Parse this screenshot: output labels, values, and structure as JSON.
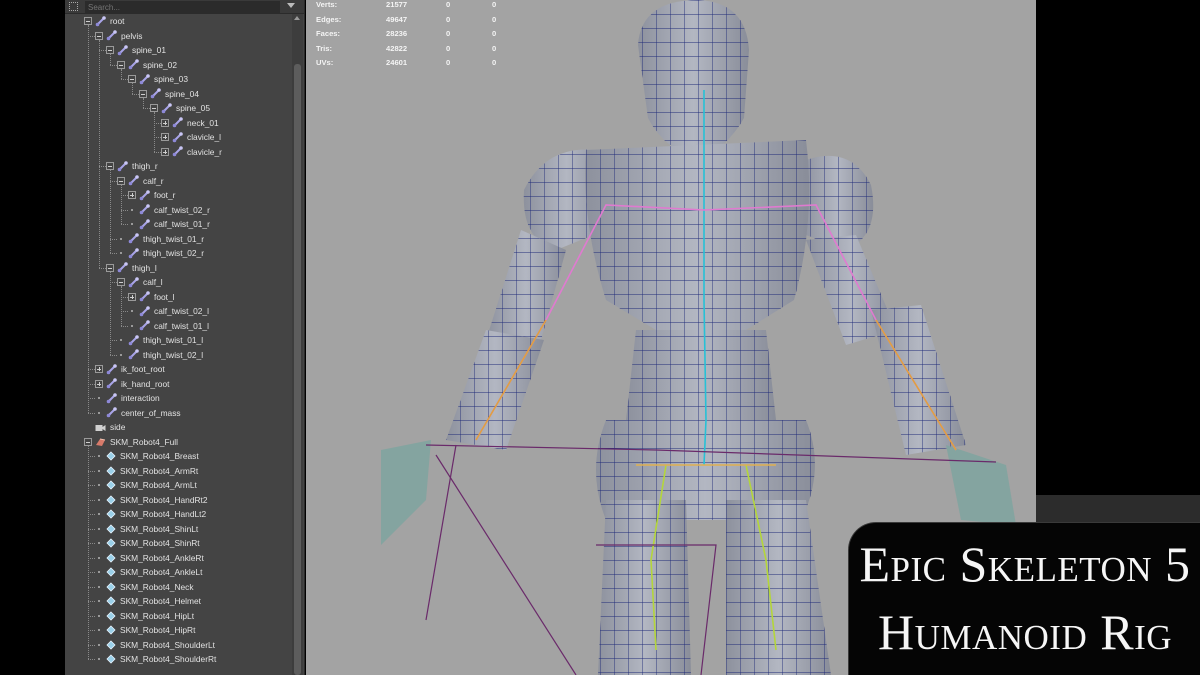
{
  "search": {
    "placeholder": "Search..."
  },
  "outliner": {
    "rows": [
      {
        "label": "root",
        "indent": 0,
        "kind": "minus",
        "icon": "joint"
      },
      {
        "label": "pelvis",
        "indent": 1,
        "kind": "minus",
        "icon": "joint"
      },
      {
        "label": "spine_01",
        "indent": 2,
        "kind": "minus",
        "icon": "joint"
      },
      {
        "label": "spine_02",
        "indent": 3,
        "kind": "minus",
        "icon": "joint"
      },
      {
        "label": "spine_03",
        "indent": 4,
        "kind": "minus",
        "icon": "joint"
      },
      {
        "label": "spine_04",
        "indent": 5,
        "kind": "minus",
        "icon": "joint"
      },
      {
        "label": "spine_05",
        "indent": 6,
        "kind": "minus",
        "icon": "joint"
      },
      {
        "label": "neck_01",
        "indent": 7,
        "kind": "plus",
        "icon": "joint"
      },
      {
        "label": "clavicle_l",
        "indent": 7,
        "kind": "plus",
        "icon": "joint"
      },
      {
        "label": "clavicle_r",
        "indent": 7,
        "kind": "plus",
        "icon": "joint"
      },
      {
        "label": "thigh_r",
        "indent": 2,
        "kind": "minus",
        "icon": "joint"
      },
      {
        "label": "calf_r",
        "indent": 3,
        "kind": "minus",
        "icon": "joint"
      },
      {
        "label": "foot_r",
        "indent": 4,
        "kind": "plus",
        "icon": "joint"
      },
      {
        "label": "calf_twist_02_r",
        "indent": 4,
        "kind": "dot",
        "icon": "joint"
      },
      {
        "label": "calf_twist_01_r",
        "indent": 4,
        "kind": "dot",
        "icon": "joint"
      },
      {
        "label": "thigh_twist_01_r",
        "indent": 3,
        "kind": "dot",
        "icon": "joint"
      },
      {
        "label": "thigh_twist_02_r",
        "indent": 3,
        "kind": "dot",
        "icon": "joint"
      },
      {
        "label": "thigh_l",
        "indent": 2,
        "kind": "minus",
        "icon": "joint"
      },
      {
        "label": "calf_l",
        "indent": 3,
        "kind": "minus",
        "icon": "joint"
      },
      {
        "label": "foot_l",
        "indent": 4,
        "kind": "plus",
        "icon": "joint"
      },
      {
        "label": "calf_twist_02_l",
        "indent": 4,
        "kind": "dot",
        "icon": "joint"
      },
      {
        "label": "calf_twist_01_l",
        "indent": 4,
        "kind": "dot",
        "icon": "joint"
      },
      {
        "label": "thigh_twist_01_l",
        "indent": 3,
        "kind": "dot",
        "icon": "joint"
      },
      {
        "label": "thigh_twist_02_l",
        "indent": 3,
        "kind": "dot",
        "icon": "joint"
      },
      {
        "label": "ik_foot_root",
        "indent": 1,
        "kind": "plus",
        "icon": "joint"
      },
      {
        "label": "ik_hand_root",
        "indent": 1,
        "kind": "plus",
        "icon": "joint"
      },
      {
        "label": "interaction",
        "indent": 1,
        "kind": "dot",
        "icon": "joint"
      },
      {
        "label": "center_of_mass",
        "indent": 1,
        "kind": "dot",
        "icon": "joint"
      },
      {
        "label": "side",
        "indent": 0,
        "kind": "none",
        "icon": "camera"
      },
      {
        "label": "SKM_Robot4_Full",
        "indent": 0,
        "kind": "minus",
        "icon": "skin"
      },
      {
        "label": "SKM_Robot4_Breast",
        "indent": 1,
        "kind": "dot",
        "icon": "mesh"
      },
      {
        "label": "SKM_Robot4_ArmRt",
        "indent": 1,
        "kind": "dot",
        "icon": "mesh"
      },
      {
        "label": "SKM_Robot4_ArmLt",
        "indent": 1,
        "kind": "dot",
        "icon": "mesh"
      },
      {
        "label": "SKM_Robot4_HandRt2",
        "indent": 1,
        "kind": "dot",
        "icon": "mesh"
      },
      {
        "label": "SKM_Robot4_HandLt2",
        "indent": 1,
        "kind": "dot",
        "icon": "mesh"
      },
      {
        "label": "SKM_Robot4_ShinLt",
        "indent": 1,
        "kind": "dot",
        "icon": "mesh"
      },
      {
        "label": "SKM_Robot4_ShinRt",
        "indent": 1,
        "kind": "dot",
        "icon": "mesh"
      },
      {
        "label": "SKM_Robot4_AnkleRt",
        "indent": 1,
        "kind": "dot",
        "icon": "mesh"
      },
      {
        "label": "SKM_Robot4_AnkleLt",
        "indent": 1,
        "kind": "dot",
        "icon": "mesh"
      },
      {
        "label": "SKM_Robot4_Neck",
        "indent": 1,
        "kind": "dot",
        "icon": "mesh"
      },
      {
        "label": "SKM_Robot4_Helmet",
        "indent": 1,
        "kind": "dot",
        "icon": "mesh"
      },
      {
        "label": "SKM_Robot4_HipLt",
        "indent": 1,
        "kind": "dot",
        "icon": "mesh"
      },
      {
        "label": "SKM_Robot4_HipRt",
        "indent": 1,
        "kind": "dot",
        "icon": "mesh"
      },
      {
        "label": "SKM_Robot4_ShoulderLt",
        "indent": 1,
        "kind": "dot",
        "icon": "mesh"
      },
      {
        "label": "SKM_Robot4_ShoulderRt",
        "indent": 1,
        "kind": "dot",
        "icon": "mesh"
      }
    ]
  },
  "hud": {
    "rows": [
      {
        "label": "Verts:",
        "v1": "21577",
        "v2": "0",
        "v3": "0"
      },
      {
        "label": "Edges:",
        "v1": "49647",
        "v2": "0",
        "v3": "0"
      },
      {
        "label": "Faces:",
        "v1": "28236",
        "v2": "0",
        "v3": "0"
      },
      {
        "label": "Tris:",
        "v1": "42822",
        "v2": "0",
        "v3": "0"
      },
      {
        "label": "UVs:",
        "v1": "24601",
        "v2": "0",
        "v3": "0"
      }
    ]
  },
  "title": {
    "line1": "Epic Skeleton 5",
    "line2": "Humanoid Rig"
  },
  "colors": {
    "outliner_bg": "#444444",
    "viewport_bg": "#a3a3a3",
    "joint_icon": "#a9a4e8",
    "wireframe": "#1f2a78",
    "mesh_fill": "#9ea2ae"
  },
  "icons": {
    "joint": "joint-icon",
    "mesh": "mesh-icon",
    "camera": "camera-icon",
    "skin": "skin-cluster-icon",
    "search": "search-icon"
  }
}
